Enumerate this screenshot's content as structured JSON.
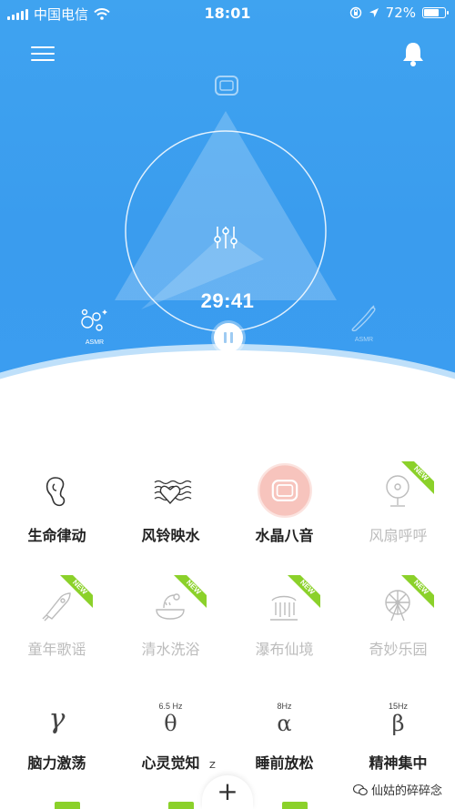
{
  "status_bar": {
    "carrier": "中国电信",
    "time": "18:01",
    "battery": "72%",
    "battery_level": 0.72
  },
  "player": {
    "timer": "29:41",
    "asmr_left": "ASMR",
    "asmr_right": "ASMR"
  },
  "sounds": [
    {
      "label": "生命律动",
      "icon": "embryo-icon",
      "state": "active"
    },
    {
      "label": "风铃映水",
      "icon": "heart-waves-icon",
      "state": "active"
    },
    {
      "label": "水晶八音",
      "icon": "music-box-icon",
      "state": "selected"
    },
    {
      "label": "风扇呼呼",
      "icon": "fan-icon",
      "state": "dim",
      "badge": "NEW"
    },
    {
      "label": "童年歌谣",
      "icon": "rocket-toy-icon",
      "state": "dim",
      "badge": "NEW"
    },
    {
      "label": "清水洗浴",
      "icon": "shower-icon",
      "state": "dim",
      "badge": "NEW"
    },
    {
      "label": "瀑布仙境",
      "icon": "waterfall-icon",
      "state": "dim",
      "badge": "NEW"
    },
    {
      "label": "奇妙乐园",
      "icon": "ferris-wheel-icon",
      "state": "dim",
      "badge": "NEW"
    },
    {
      "label": "脑力激荡",
      "icon": "gamma-wave-icon",
      "state": "active",
      "symbol": "γ",
      "hz": ""
    },
    {
      "label": "心灵觉知",
      "icon": "theta-wave-icon",
      "state": "active",
      "symbol": "θ",
      "hz": "6.5 Hz"
    },
    {
      "label": "睡前放松",
      "icon": "alpha-wave-icon",
      "state": "active",
      "symbol": "α",
      "hz": "8Hz"
    },
    {
      "label": "精神集中",
      "icon": "beta-wave-icon",
      "state": "active",
      "symbol": "β",
      "hz": "15Hz"
    }
  ],
  "footer": {
    "z_mark": "Z",
    "plus": "+",
    "watermark": "仙姑的碎碎念"
  },
  "colors": {
    "primary": "#3b9df0",
    "new_badge": "#8bd12a",
    "selected_circle": "#f7c4bd",
    "dim_text": "#bcbcbc"
  }
}
